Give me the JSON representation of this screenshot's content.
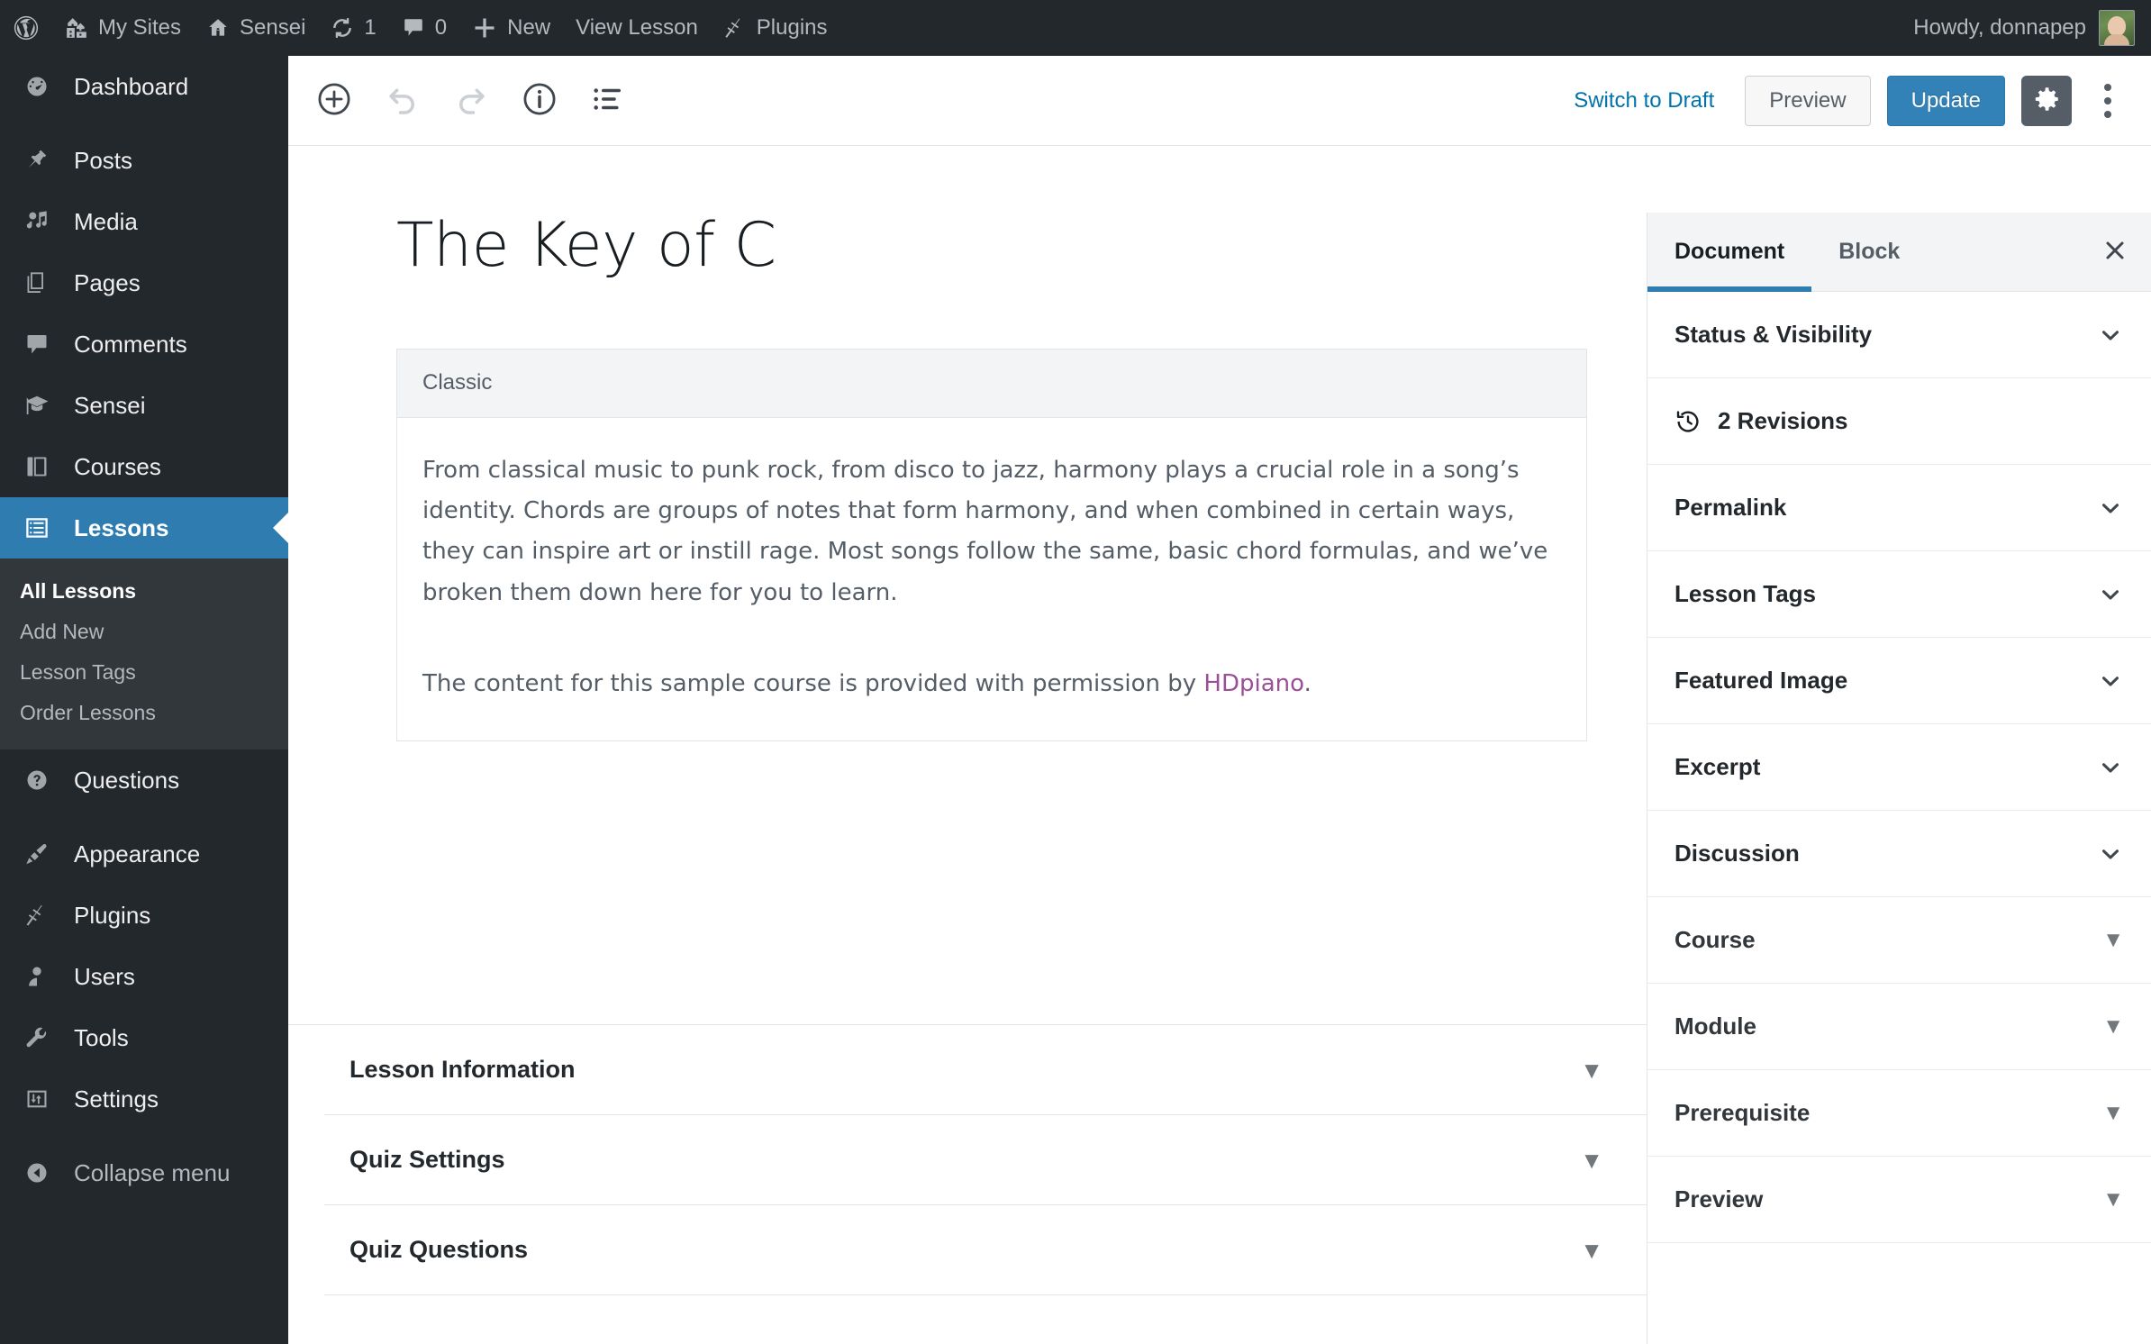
{
  "adminbar": {
    "left_items": [
      {
        "icon": "wordpress-logo-icon",
        "label": ""
      },
      {
        "icon": "buildings-icon",
        "label": "My Sites"
      },
      {
        "icon": "home-icon",
        "label": "Sensei"
      },
      {
        "icon": "updates-icon",
        "label": "1"
      },
      {
        "icon": "comment-bubble-icon",
        "label": "0"
      },
      {
        "icon": "plus-icon",
        "label": "New"
      },
      {
        "icon": "",
        "label": "View Lesson"
      },
      {
        "icon": "plugins-plug-icon",
        "label": "Plugins"
      }
    ],
    "greeting": "Howdy, donnapep"
  },
  "adminmenu": {
    "items": [
      {
        "label": "Dashboard",
        "icon": "dashboard-icon",
        "current": false
      },
      {
        "label": "Posts",
        "icon": "pin-icon",
        "current": false
      },
      {
        "label": "Media",
        "icon": "media-icon",
        "current": false
      },
      {
        "label": "Pages",
        "icon": "pages-icon",
        "current": false
      },
      {
        "label": "Comments",
        "icon": "comments-icon",
        "current": false
      },
      {
        "label": "Sensei",
        "icon": "graduation-cap-icon",
        "current": false
      },
      {
        "label": "Courses",
        "icon": "book-icon",
        "current": false
      },
      {
        "label": "Lessons",
        "icon": "list-icon",
        "current": true
      }
    ],
    "submenu": [
      {
        "label": "All Lessons",
        "current": true
      },
      {
        "label": "Add New",
        "current": false
      },
      {
        "label": "Lesson Tags",
        "current": false
      },
      {
        "label": "Order Lessons",
        "current": false
      }
    ],
    "items_after": [
      {
        "label": "Questions",
        "icon": "question-mark-icon",
        "current": false
      },
      {
        "label": "Appearance",
        "icon": "paintbrush-icon",
        "current": false
      },
      {
        "label": "Plugins",
        "icon": "plugins-plug-icon",
        "current": false
      },
      {
        "label": "Users",
        "icon": "user-icon",
        "current": false
      },
      {
        "label": "Tools",
        "icon": "wrench-icon",
        "current": false
      },
      {
        "label": "Settings",
        "icon": "settings-sliders-icon",
        "current": false
      }
    ],
    "collapse_label": "Collapse menu"
  },
  "editor_header": {
    "tools": [
      {
        "name": "add-block-icon",
        "disabled": false
      },
      {
        "name": "undo-icon",
        "disabled": true
      },
      {
        "name": "redo-icon",
        "disabled": true
      },
      {
        "name": "info-icon",
        "disabled": false
      },
      {
        "name": "list-view-icon",
        "disabled": false
      }
    ],
    "switch_to_draft": "Switch to Draft",
    "preview": "Preview",
    "update": "Update",
    "accent_blue": "#3282b8"
  },
  "post": {
    "title": "The Key of C",
    "block": {
      "name": "Classic",
      "paragraph_1": "From classical music to punk rock, from disco to jazz, harmony plays a crucial role in a song’s identity. Chords are groups of notes that form harmony, and when combined in certain ways, they can inspire art or instill rage. Most songs follow the same, basic chord formulas, and we’ve broken them down here for you to learn.",
      "paragraph_2_before": "The content for this sample course is provided with permission by ",
      "paragraph_2_link": "HDpiano",
      "paragraph_2_after": ".",
      "link_color": "#9b4f96"
    }
  },
  "metaboxes": [
    {
      "title": "Lesson Information",
      "toggle": "▼"
    },
    {
      "title": "Quiz Settings",
      "toggle": "▼"
    },
    {
      "title": "Quiz Questions",
      "toggle": "▼"
    }
  ],
  "settings_sidebar": {
    "tabs": [
      {
        "label": "Document",
        "active": true
      },
      {
        "label": "Block",
        "active": false
      }
    ],
    "panels": [
      {
        "label": "Status & Visibility",
        "arrow": "chevron"
      },
      {
        "label": "2 Revisions",
        "arrow": "none",
        "icon": "revisions-clock-icon"
      },
      {
        "label": "Permalink",
        "arrow": "chevron"
      },
      {
        "label": "Lesson Tags",
        "arrow": "chevron"
      },
      {
        "label": "Featured Image",
        "arrow": "chevron"
      },
      {
        "label": "Excerpt",
        "arrow": "chevron"
      },
      {
        "label": "Discussion",
        "arrow": "chevron"
      },
      {
        "label": "Course",
        "arrow": "triangle"
      },
      {
        "label": "Module",
        "arrow": "triangle"
      },
      {
        "label": "Prerequisite",
        "arrow": "triangle"
      },
      {
        "label": "Preview",
        "arrow": "triangle"
      }
    ],
    "triangle_glyph": "▼"
  }
}
